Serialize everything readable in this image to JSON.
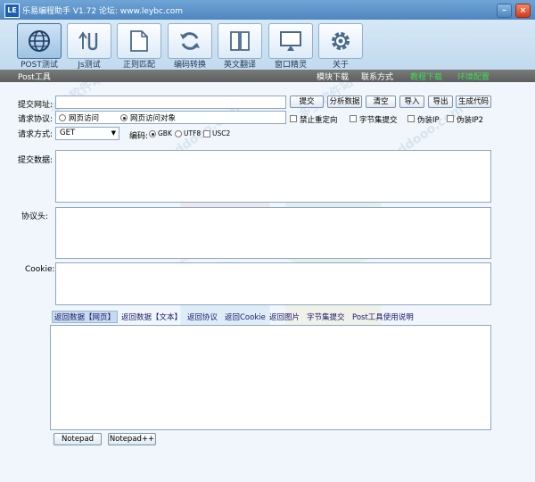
{
  "window": {
    "logo_text": "LE",
    "title": "乐易编程助手 V1.72 论坛: www.leybc.com",
    "min_symbol": "–",
    "close_symbol": "×"
  },
  "toolbar": {
    "tools": [
      {
        "label": "POST测试",
        "icon": "globe-icon"
      },
      {
        "label": "Js测试",
        "icon": "js-arrows-icon"
      },
      {
        "label": "正则匹配",
        "icon": "document-icon"
      },
      {
        "label": "编码转换",
        "icon": "refresh-icon"
      },
      {
        "label": "英文翻译",
        "icon": "book-icon"
      },
      {
        "label": "窗口精灵",
        "icon": "monitor-icon"
      },
      {
        "label": "关于",
        "icon": "gear-icon"
      }
    ]
  },
  "navbar": {
    "title": "Post工具",
    "links": [
      {
        "label": "模块下载",
        "color": "#ffffff"
      },
      {
        "label": "联系方式",
        "color": "#ffffff"
      },
      {
        "label": "教程下载",
        "color": "#3fdc55"
      },
      {
        "label": "环境配置",
        "color": "#3fdc55"
      }
    ]
  },
  "form": {
    "url_label": "提交网址:",
    "url_value": "",
    "buttons": [
      "提交",
      "分析数据",
      "清空",
      "导入",
      "导出",
      "生成代码"
    ],
    "protocol_label": "请求协议:",
    "protocol_options": [
      {
        "label": "网页访问",
        "checked": false
      },
      {
        "label": "网页访问对象",
        "checked": true
      }
    ],
    "checkboxes": [
      "禁止重定向",
      "字节集提交",
      "伪装IP",
      "伪装IP2"
    ],
    "method_label": "请求方式:",
    "method_value": "GET",
    "encoding_label": "编码:",
    "encoding_options": [
      {
        "label": "GBK",
        "checked": true
      },
      {
        "label": "UTF8",
        "checked": false
      }
    ],
    "usc2_label": "USC2",
    "postdata_label": "提交数据:",
    "headers_label": "协议头:",
    "cookie_label": "Cookie:"
  },
  "result_tabs": [
    "返回数据【网页】",
    "返回数据【文本】",
    "返回协议",
    "返回Cookie",
    "返回图片",
    "字节集提交",
    "Post工具使用说明"
  ],
  "bottom_buttons": [
    "Notepad",
    "Notepad++"
  ],
  "watermarks": [
    "多多软件站",
    "www.ddooo.com"
  ]
}
